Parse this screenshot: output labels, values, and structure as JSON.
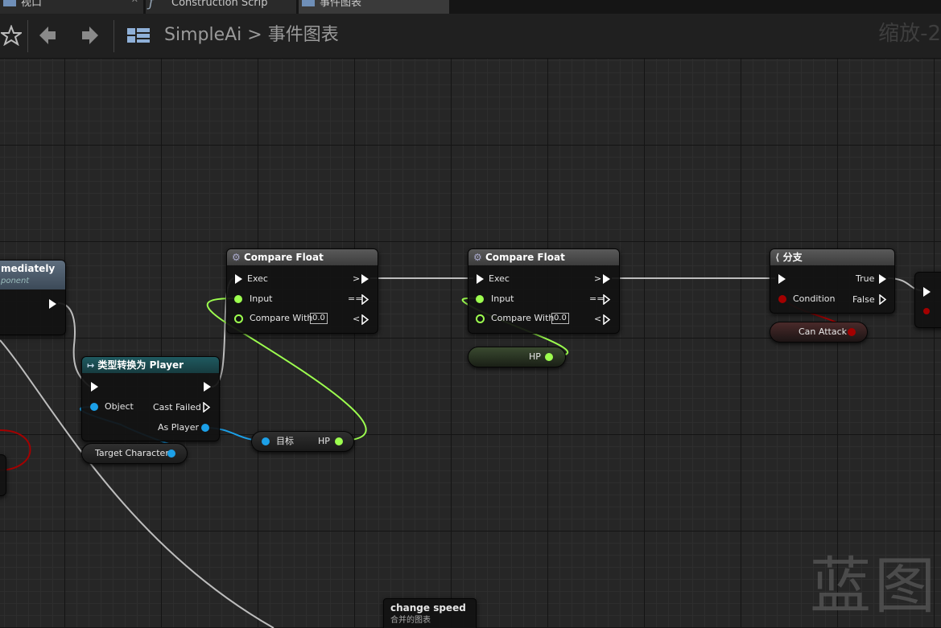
{
  "tabs": [
    {
      "label": "视口"
    },
    {
      "label": "Construction Scrip"
    },
    {
      "label": "事件图表"
    }
  ],
  "toolbar": {
    "breadcrumb_root": "SimpleAi",
    "breadcrumb_sep": ">",
    "breadcrumb_current": "事件图表",
    "zoom": "缩放-2"
  },
  "nodes": {
    "left_partial": {
      "title": "mediately",
      "subtitle": "ponent"
    },
    "cast": {
      "title": "类型转换为 Player",
      "object": "Object",
      "cast_failed": "Cast Failed",
      "as_player": "As Player"
    },
    "compare1": {
      "title": "Compare Float",
      "exec": "Exec",
      "input": "Input",
      "compare_with": "Compare With",
      "value": "0.0",
      "out_gt": ">",
      "out_eq": "==",
      "out_lt": "<"
    },
    "compare2": {
      "title": "Compare Float",
      "exec": "Exec",
      "input": "Input",
      "compare_with": "Compare With",
      "value": "0.0",
      "out_gt": ">",
      "out_eq": "==",
      "out_lt": "<"
    },
    "branch": {
      "title": "分支",
      "condition": "Condition",
      "true": "True",
      "false": "False"
    },
    "comment": {
      "title": "change speed",
      "subtitle": "合并的图表"
    }
  },
  "vars": {
    "target_character": "Target Character",
    "target_label": "目标",
    "hp": "HP",
    "hp2": "HP",
    "can_attack": "Can Attack"
  },
  "watermark": "蓝图",
  "colors": {
    "float_pin": "#9dff4f",
    "object_pin": "#1ca0e8",
    "bool_pin": "#a30000",
    "exec": "#ffffff"
  }
}
